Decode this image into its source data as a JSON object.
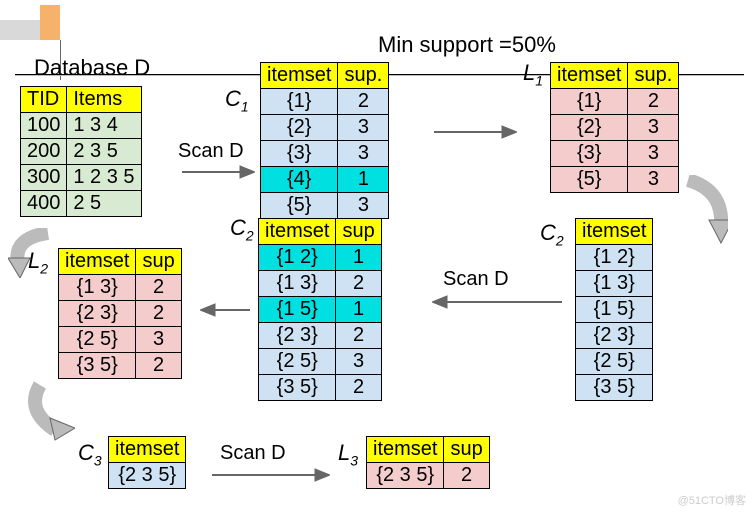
{
  "title_min_support": "Min support =50%",
  "title_database": "Database D",
  "labels": {
    "C1": "C",
    "C1s": "1",
    "L1": "L",
    "L1s": "1",
    "C2a": "C",
    "C2as": "2",
    "C2b": "C",
    "C2bs": "2",
    "L2": "L",
    "L2s": "2",
    "C3": "C",
    "C3s": "3",
    "L3": "L",
    "L3s": "3",
    "scanD1": "Scan D",
    "scanD2": "Scan D",
    "scanD3": "Scan D"
  },
  "headers": {
    "tid": "TID",
    "items": "Items",
    "itemset": "itemset",
    "sup": "sup.",
    "sup2": "sup"
  },
  "D": [
    {
      "tid": "100",
      "items": "1 3 4"
    },
    {
      "tid": "200",
      "items": "2 3 5"
    },
    {
      "tid": "300",
      "items": "1 2 3 5"
    },
    {
      "tid": "400",
      "items": "2 5"
    }
  ],
  "C1": [
    {
      "set": "{1}",
      "sup": "2",
      "hl": false
    },
    {
      "set": "{2}",
      "sup": "3",
      "hl": false
    },
    {
      "set": "{3}",
      "sup": "3",
      "hl": false
    },
    {
      "set": "{4}",
      "sup": "1",
      "hl": true
    },
    {
      "set": "{5}",
      "sup": "3",
      "hl": false
    }
  ],
  "L1": [
    {
      "set": "{1}",
      "sup": "2"
    },
    {
      "set": "{2}",
      "sup": "3"
    },
    {
      "set": "{3}",
      "sup": "3"
    },
    {
      "set": "{5}",
      "sup": "3"
    }
  ],
  "C2_items": [
    "{1 2}",
    "{1 3}",
    "{1 5}",
    "{2 3}",
    "{2 5}",
    "{3 5}"
  ],
  "C2_sup": [
    {
      "set": "{1 2}",
      "sup": "1",
      "hl": true
    },
    {
      "set": "{1 3}",
      "sup": "2",
      "hl": false
    },
    {
      "set": "{1 5}",
      "sup": "1",
      "hl": true
    },
    {
      "set": "{2 3}",
      "sup": "2",
      "hl": false
    },
    {
      "set": "{2 5}",
      "sup": "3",
      "hl": false
    },
    {
      "set": "{3 5}",
      "sup": "2",
      "hl": false
    }
  ],
  "L2": [
    {
      "set": "{1 3}",
      "sup": "2"
    },
    {
      "set": "{2 3}",
      "sup": "2"
    },
    {
      "set": "{2 5}",
      "sup": "3"
    },
    {
      "set": "{3 5}",
      "sup": "2"
    }
  ],
  "C3": [
    {
      "set": "{2 3 5}"
    }
  ],
  "L3": [
    {
      "set": "{2 3 5}",
      "sup": "2"
    }
  ],
  "watermark": "@51CTO博客",
  "chart_data": {
    "type": "table",
    "title": "Apriori algorithm example, Min support = 50%",
    "database": [
      {
        "TID": 100,
        "Items": [
          1,
          3,
          4
        ]
      },
      {
        "TID": 200,
        "Items": [
          2,
          3,
          5
        ]
      },
      {
        "TID": 300,
        "Items": [
          1,
          2,
          3,
          5
        ]
      },
      {
        "TID": 400,
        "Items": [
          2,
          5
        ]
      }
    ],
    "C1": [
      {
        "itemset": [
          1
        ],
        "sup": 2
      },
      {
        "itemset": [
          2
        ],
        "sup": 3
      },
      {
        "itemset": [
          3
        ],
        "sup": 3
      },
      {
        "itemset": [
          4
        ],
        "sup": 1
      },
      {
        "itemset": [
          5
        ],
        "sup": 3
      }
    ],
    "L1": [
      {
        "itemset": [
          1
        ],
        "sup": 2
      },
      {
        "itemset": [
          2
        ],
        "sup": 3
      },
      {
        "itemset": [
          3
        ],
        "sup": 3
      },
      {
        "itemset": [
          5
        ],
        "sup": 3
      }
    ],
    "C2_candidates": [
      [
        1,
        2
      ],
      [
        1,
        3
      ],
      [
        1,
        5
      ],
      [
        2,
        3
      ],
      [
        2,
        5
      ],
      [
        3,
        5
      ]
    ],
    "C2_scanned": [
      {
        "itemset": [
          1,
          2
        ],
        "sup": 1
      },
      {
        "itemset": [
          1,
          3
        ],
        "sup": 2
      },
      {
        "itemset": [
          1,
          5
        ],
        "sup": 1
      },
      {
        "itemset": [
          2,
          3
        ],
        "sup": 2
      },
      {
        "itemset": [
          2,
          5
        ],
        "sup": 3
      },
      {
        "itemset": [
          3,
          5
        ],
        "sup": 2
      }
    ],
    "L2": [
      {
        "itemset": [
          1,
          3
        ],
        "sup": 2
      },
      {
        "itemset": [
          2,
          3
        ],
        "sup": 2
      },
      {
        "itemset": [
          2,
          5
        ],
        "sup": 3
      },
      {
        "itemset": [
          3,
          5
        ],
        "sup": 2
      }
    ],
    "C3": [
      [
        2,
        3,
        5
      ]
    ],
    "L3": [
      {
        "itemset": [
          2,
          3,
          5
        ],
        "sup": 2
      }
    ]
  }
}
